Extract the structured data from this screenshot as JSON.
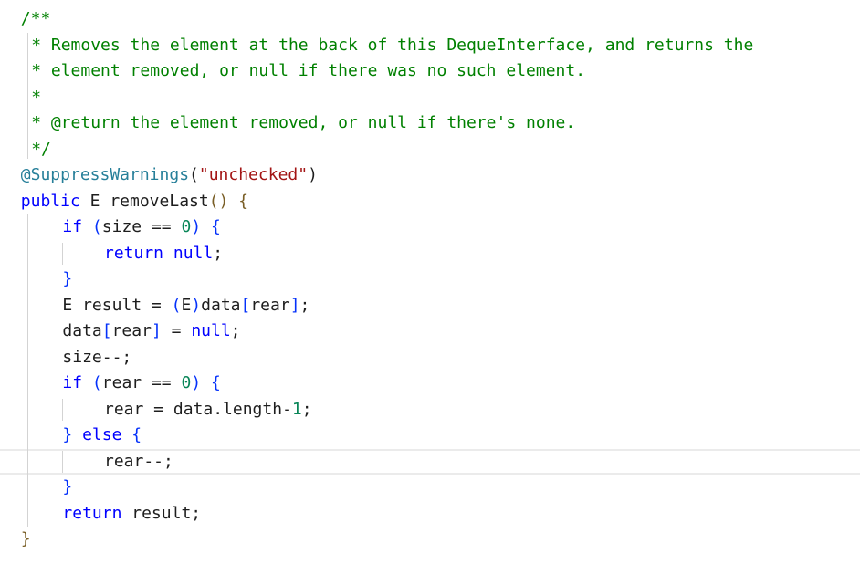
{
  "editor": {
    "lines": [
      {
        "indent": 2,
        "tokens": [
          {
            "t": "comment",
            "v": "/**"
          }
        ]
      },
      {
        "indent": 3,
        "tokens": [
          {
            "t": "comment",
            "v": "* Removes the element at the back of this DequeInterface, and returns the"
          }
        ]
      },
      {
        "indent": 3,
        "tokens": [
          {
            "t": "comment",
            "v": "* element removed, or null if there was no such element."
          }
        ]
      },
      {
        "indent": 3,
        "tokens": [
          {
            "t": "comment",
            "v": "*"
          }
        ]
      },
      {
        "indent": 3,
        "tokens": [
          {
            "t": "comment",
            "v": "* @return the element removed, or null if there's none."
          }
        ]
      },
      {
        "indent": 3,
        "tokens": [
          {
            "t": "comment",
            "v": "*/"
          }
        ]
      },
      {
        "indent": 2,
        "tokens": [
          {
            "t": "annotation",
            "v": "@SuppressWarnings"
          },
          {
            "t": "op",
            "v": "("
          },
          {
            "t": "string",
            "v": "\"unchecked\""
          },
          {
            "t": "op",
            "v": ")"
          }
        ]
      },
      {
        "indent": 2,
        "tokens": [
          {
            "t": "keyword",
            "v": "public"
          },
          {
            "t": "op",
            "v": " E removeLast"
          },
          {
            "t": "bracket-y",
            "v": "()"
          },
          {
            "t": "op",
            "v": " "
          },
          {
            "t": "bracket-y",
            "v": "{"
          }
        ]
      },
      {
        "indent": 6,
        "tokens": [
          {
            "t": "keyword",
            "v": "if"
          },
          {
            "t": "op",
            "v": " "
          },
          {
            "t": "bracket",
            "v": "("
          },
          {
            "t": "op",
            "v": "size == "
          },
          {
            "t": "number",
            "v": "0"
          },
          {
            "t": "bracket",
            "v": ")"
          },
          {
            "t": "op",
            "v": " "
          },
          {
            "t": "bracket",
            "v": "{"
          }
        ]
      },
      {
        "indent": 10,
        "tokens": [
          {
            "t": "keyword",
            "v": "return"
          },
          {
            "t": "op",
            "v": " "
          },
          {
            "t": "keyword",
            "v": "null"
          },
          {
            "t": "op",
            "v": ";"
          }
        ]
      },
      {
        "indent": 6,
        "tokens": [
          {
            "t": "bracket",
            "v": "}"
          }
        ]
      },
      {
        "indent": 6,
        "tokens": [
          {
            "t": "op",
            "v": "E result = "
          },
          {
            "t": "bracket",
            "v": "("
          },
          {
            "t": "op",
            "v": "E"
          },
          {
            "t": "bracket",
            "v": ")"
          },
          {
            "t": "op",
            "v": "data"
          },
          {
            "t": "bracket",
            "v": "["
          },
          {
            "t": "op",
            "v": "rear"
          },
          {
            "t": "bracket",
            "v": "]"
          },
          {
            "t": "op",
            "v": ";"
          }
        ]
      },
      {
        "indent": 6,
        "tokens": [
          {
            "t": "op",
            "v": "data"
          },
          {
            "t": "bracket",
            "v": "["
          },
          {
            "t": "op",
            "v": "rear"
          },
          {
            "t": "bracket",
            "v": "]"
          },
          {
            "t": "op",
            "v": " = "
          },
          {
            "t": "keyword",
            "v": "null"
          },
          {
            "t": "op",
            "v": ";"
          }
        ]
      },
      {
        "indent": 6,
        "tokens": [
          {
            "t": "op",
            "v": "size--;"
          }
        ]
      },
      {
        "indent": 6,
        "tokens": [
          {
            "t": "keyword",
            "v": "if"
          },
          {
            "t": "op",
            "v": " "
          },
          {
            "t": "bracket",
            "v": "("
          },
          {
            "t": "op",
            "v": "rear == "
          },
          {
            "t": "number",
            "v": "0"
          },
          {
            "t": "bracket",
            "v": ")"
          },
          {
            "t": "op",
            "v": " "
          },
          {
            "t": "bracket",
            "v": "{"
          }
        ]
      },
      {
        "indent": 10,
        "tokens": [
          {
            "t": "op",
            "v": "rear = data.length-"
          },
          {
            "t": "number",
            "v": "1"
          },
          {
            "t": "op",
            "v": ";"
          }
        ]
      },
      {
        "indent": 6,
        "tokens": [
          {
            "t": "bracket",
            "v": "}"
          },
          {
            "t": "op",
            "v": " "
          },
          {
            "t": "keyword",
            "v": "else"
          },
          {
            "t": "op",
            "v": " "
          },
          {
            "t": "bracket",
            "v": "{"
          }
        ]
      },
      {
        "indent": 10,
        "tokens": [
          {
            "t": "op",
            "v": "rear--;"
          }
        ]
      },
      {
        "indent": 6,
        "tokens": [
          {
            "t": "bracket",
            "v": "}"
          }
        ]
      },
      {
        "indent": 6,
        "tokens": [
          {
            "t": "keyword",
            "v": "return"
          },
          {
            "t": "op",
            "v": " result;"
          }
        ]
      },
      {
        "indent": 2,
        "tokens": [
          {
            "t": "bracket-y",
            "v": "}"
          }
        ]
      }
    ]
  }
}
